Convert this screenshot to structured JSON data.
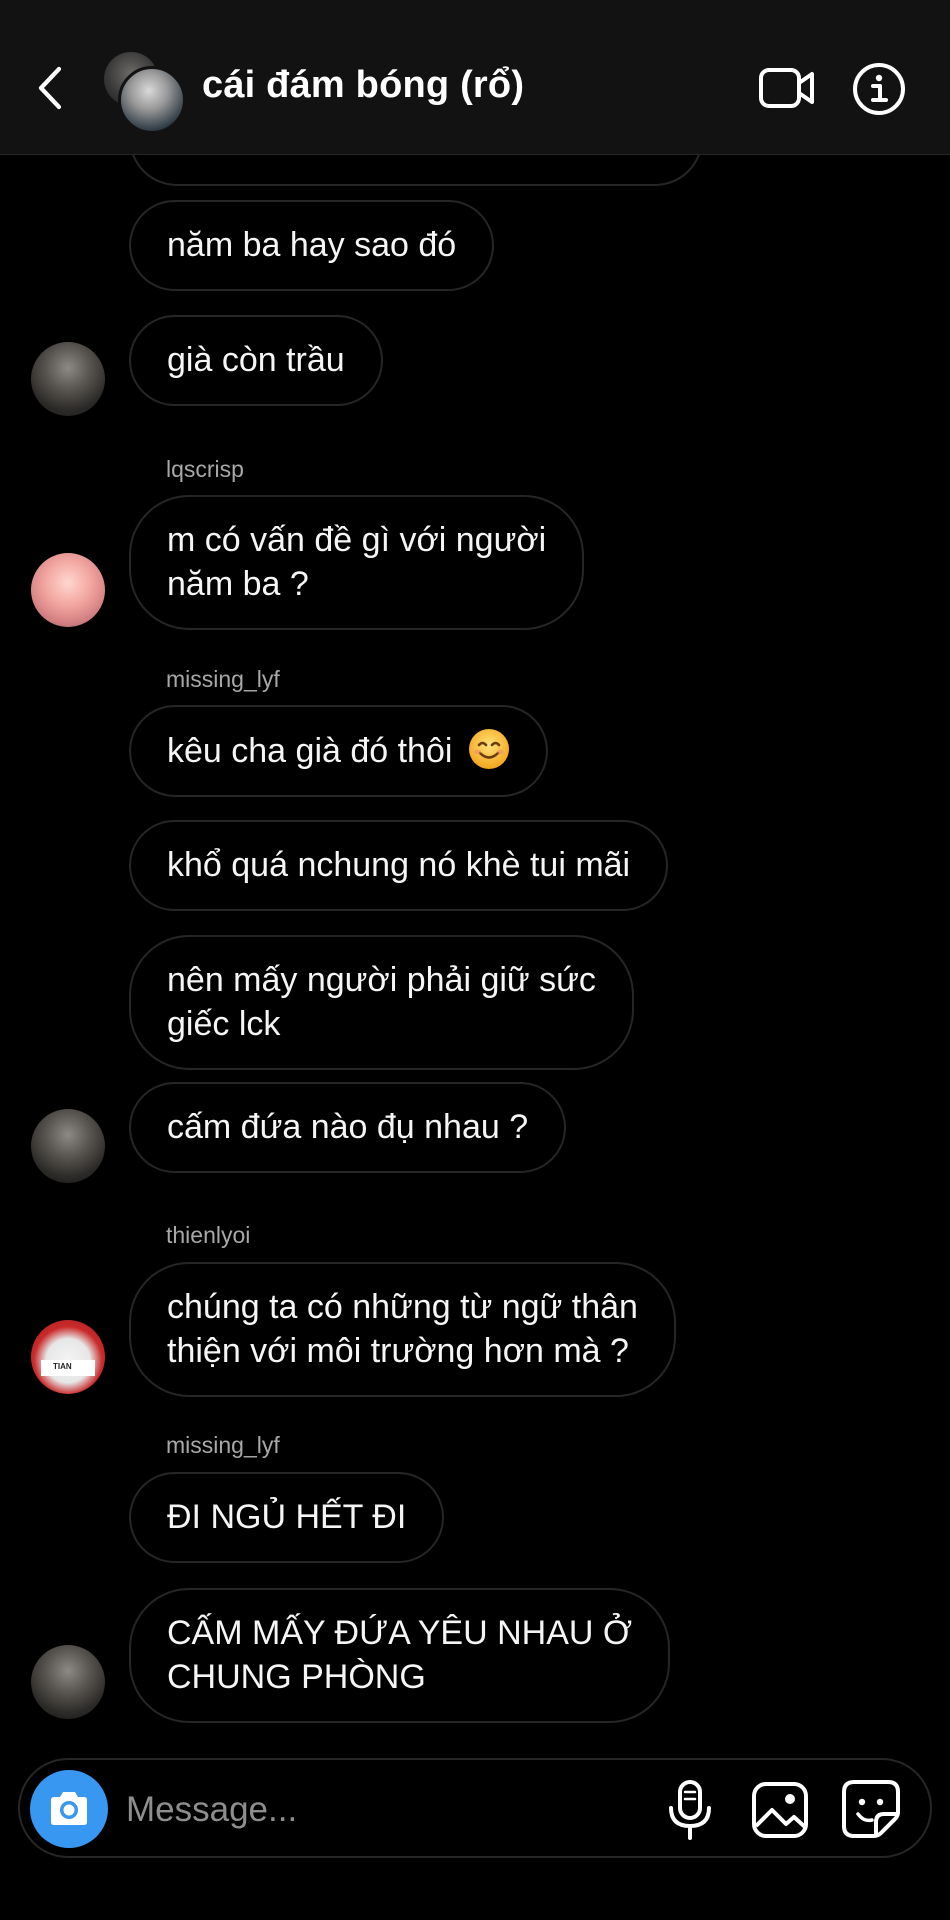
{
  "header": {
    "title": "cái đám bóng (rổ)",
    "back_icon": "chevron-left-icon",
    "video_icon": "video-camera-icon",
    "info_icon": "info-icon"
  },
  "messages": [
    {
      "text": ""
    },
    {
      "text": "năm ba hay sao đó"
    },
    {
      "text": "già còn trầu"
    },
    {
      "sender": "lqscrisp"
    },
    {
      "text": "m có vấn đề gì với người",
      "text2": "năm ba ?"
    },
    {
      "sender": "missing_lyf"
    },
    {
      "text": "kêu cha già đó thôi",
      "emoji": "smiling-face-icon"
    },
    {
      "text": "khổ quá nchung nó khè tui mãi"
    },
    {
      "text": "nên mấy người phải giữ sức",
      "text2": "giếc lck"
    },
    {
      "text": "cấm đứa nào đụ nhau ?"
    },
    {
      "sender": "thienlyoi"
    },
    {
      "text": "chúng ta có những từ ngữ thân",
      "text2": "thiện với môi trường hơn mà ?"
    },
    {
      "sender": "missing_lyf"
    },
    {
      "text": "ĐI NGỦ HẾT ĐI"
    },
    {
      "text": "CẤM MẤY ĐỨA YÊU NHAU Ở",
      "text2": "CHUNG PHÒNG"
    }
  ],
  "avatar_labels": {
    "tian": "TIAN"
  },
  "composer": {
    "placeholder": "Message...",
    "camera_icon": "camera-icon",
    "mic_icon": "microphone-icon",
    "gallery_icon": "image-gallery-icon",
    "sticker_icon": "sticker-icon"
  },
  "colors": {
    "background": "#000000",
    "header_bg": "#121212",
    "bubble_border": "#262626",
    "sender_text": "#a8a8a8",
    "camera_accent": "#3897f0"
  }
}
